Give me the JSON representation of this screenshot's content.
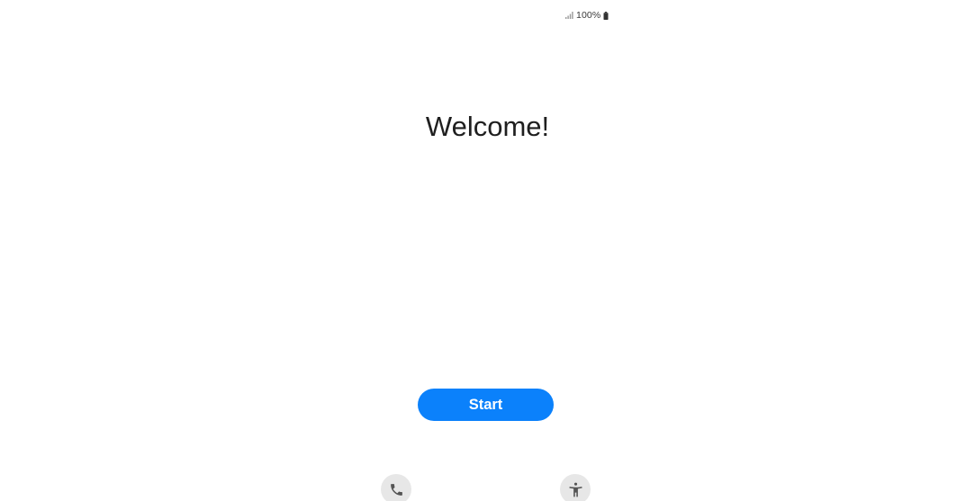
{
  "status_bar": {
    "battery_text": "100%",
    "signal_icon": "signal-icon",
    "battery_icon": "battery-icon"
  },
  "main": {
    "title": "Welcome!",
    "start_label": "Start"
  },
  "bottom": {
    "call_icon": "phone-icon",
    "accessibility_icon": "accessibility-icon"
  },
  "colors": {
    "accent": "#0b81fb",
    "background": "#ffffff",
    "round_button_bg": "#e7e7e7",
    "icon_gray": "#555555"
  }
}
